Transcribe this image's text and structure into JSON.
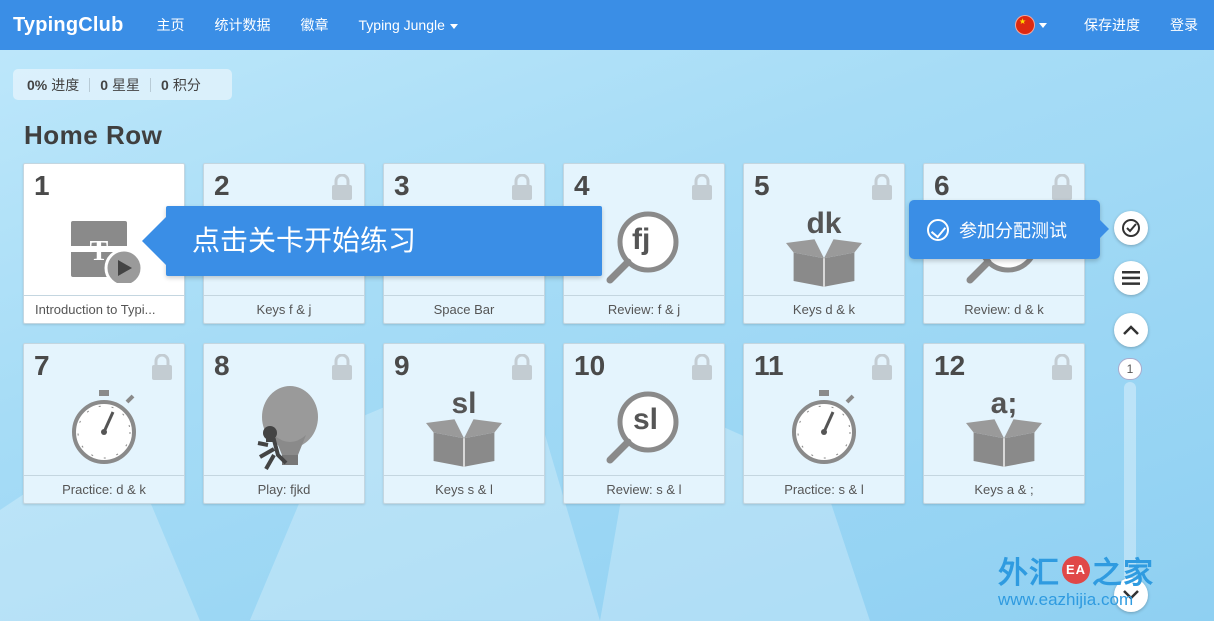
{
  "nav": {
    "brand": "TypingClub",
    "items": [
      "主页",
      "统计数据",
      "徽章",
      "Typing Jungle"
    ],
    "save": "保存进度",
    "login": "登录"
  },
  "stats": {
    "progress_value": "0%",
    "progress_label": "进度",
    "stars_value": "0",
    "stars_label": "星星",
    "points_value": "0",
    "points_label": "积分"
  },
  "section_title": "Home Row",
  "lessons": [
    {
      "num": "1",
      "label": "Introduction to Typi...",
      "icon": "intro-video-icon",
      "locked": false
    },
    {
      "num": "2",
      "label": "Keys f & j",
      "icon": "box-icon",
      "locked": true
    },
    {
      "num": "3",
      "label": "Space Bar",
      "icon": "box-icon",
      "locked": true
    },
    {
      "num": "4",
      "label": "Review: f & j",
      "icon": "magnifier-icon",
      "glyph": "fj",
      "locked": true
    },
    {
      "num": "5",
      "label": "Keys d & k",
      "icon": "box-icon",
      "glyph": "dk",
      "locked": true
    },
    {
      "num": "6",
      "label": "Review: d & k",
      "icon": "magnifier-icon",
      "locked": true
    },
    {
      "num": "7",
      "label": "Practice: d & k",
      "icon": "stopwatch-icon",
      "locked": true
    },
    {
      "num": "8",
      "label": "Play: fjkd",
      "icon": "balloon-game-icon",
      "locked": true
    },
    {
      "num": "9",
      "label": "Keys s & l",
      "icon": "box-icon",
      "glyph": "sl",
      "locked": true
    },
    {
      "num": "10",
      "label": "Review: s & l",
      "icon": "magnifier-icon",
      "glyph": "sl",
      "locked": true
    },
    {
      "num": "11",
      "label": "Practice: s & l",
      "icon": "stopwatch-icon",
      "locked": true
    },
    {
      "num": "12",
      "label": "Keys a & ;",
      "icon": "box-icon",
      "glyph": "a;",
      "locked": true
    }
  ],
  "tooltip": "点击关卡开始练习",
  "placement_test": "参加分配测试",
  "page_number": "1",
  "watermark": {
    "title_left": "外汇",
    "seal": "EA",
    "title_right": "之家",
    "url": "www.eazhijia.com"
  },
  "colors": {
    "nav_blue": "#3a8ee6",
    "card_bg": "#e4f4fd",
    "icon_gray": "#8a8a8a"
  }
}
